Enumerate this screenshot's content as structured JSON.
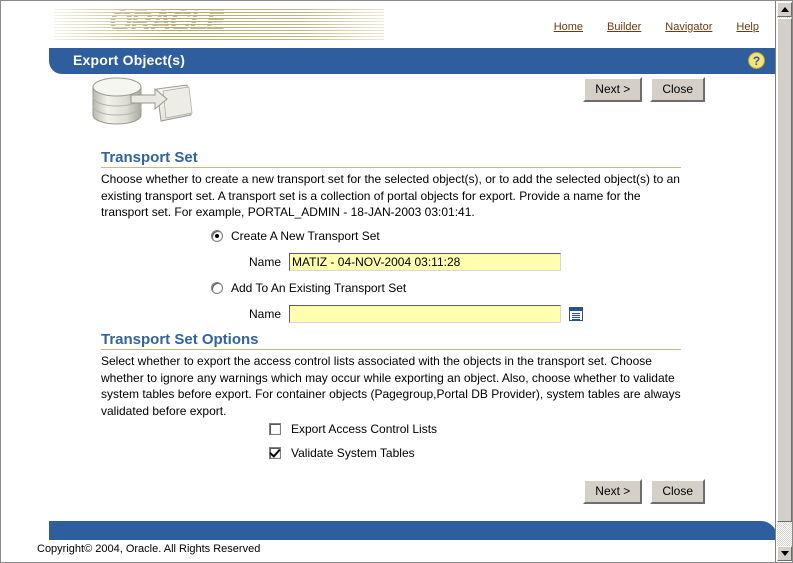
{
  "banner": {
    "logo_text": "ORACLE",
    "nav": [
      {
        "label": "Home"
      },
      {
        "label": "Builder"
      },
      {
        "label": "Navigator"
      },
      {
        "label": "Help"
      }
    ]
  },
  "titlebar": {
    "title": "Export Object(s)",
    "help_icon": "question-mark-icon",
    "help_glyph": "?"
  },
  "toolbar": {
    "next_label": "Next >",
    "close_label": "Close"
  },
  "sections": {
    "transport_set": {
      "heading": "Transport Set",
      "description": "Choose whether to create a new transport set for the selected object(s), or to add the selected object(s) to an existing transport set. A transport set is a collection of portal objects for export. Provide a name for the transport set. For example, PORTAL_ADMIN - 18-JAN-2003 03:01:41.",
      "radio_new_label": "Create A New Transport Set",
      "radio_new_selected": true,
      "name_new_label": "Name",
      "name_new_value": "MATIZ - 04-NOV-2004 03:11:28",
      "name_new_placeholder": "",
      "radio_existing_label": "Add To An Existing Transport Set",
      "radio_existing_selected": false,
      "name_existing_label": "Name",
      "name_existing_value": "",
      "name_existing_placeholder": "",
      "browse_icon": "list-browse-icon"
    },
    "transport_set_options": {
      "heading": "Transport Set Options",
      "description": "Select whether to export the access control lists associated with the objects in the transport set. Choose whether to ignore any warnings which may occur while exporting an object. Also, choose whether to validate system tables before export. For container objects (Pagegroup,Portal DB Provider), system tables are always validated before export.",
      "checkbox_acl_label": "Export Access Control Lists",
      "checkbox_acl_checked": false,
      "checkbox_validate_label": "Validate System Tables",
      "checkbox_validate_checked": true
    }
  },
  "footer": {
    "copyright": "Copyright© 2004, Oracle. All Rights Reserved"
  },
  "colors": {
    "title_bar_blue": "#2f5e9e",
    "heading_blue": "#33639c",
    "rule_khaki": "#c3bb88",
    "field_yellow": "#ffffb0",
    "nav_link_brown": "#6b3b12",
    "button_face": "#d4d0c8",
    "help_icon_yellow": "#f5e47a"
  }
}
